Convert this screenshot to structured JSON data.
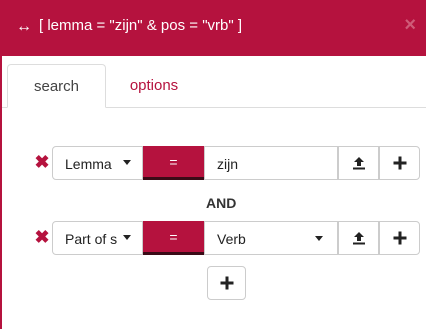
{
  "dialog": {
    "title": "[ lemma = \"zijn\" & pos = \"vrb\" ]",
    "move_icon": "↔",
    "close_icon": "×"
  },
  "tabs": [
    {
      "label": "search",
      "active": true
    },
    {
      "label": "options",
      "active": false
    }
  ],
  "rules": [
    {
      "field": "Lemma",
      "operator": "=",
      "value": "zijn",
      "has_dropdown": false
    },
    {
      "field": "Part of s",
      "operator": "=",
      "value": "Verb",
      "has_dropdown": true
    }
  ],
  "connector": "AND",
  "icons": {
    "delete": "✖",
    "upload": "upload-icon",
    "plus": "plus-icon"
  },
  "colors": {
    "accent": "#b5123e"
  }
}
